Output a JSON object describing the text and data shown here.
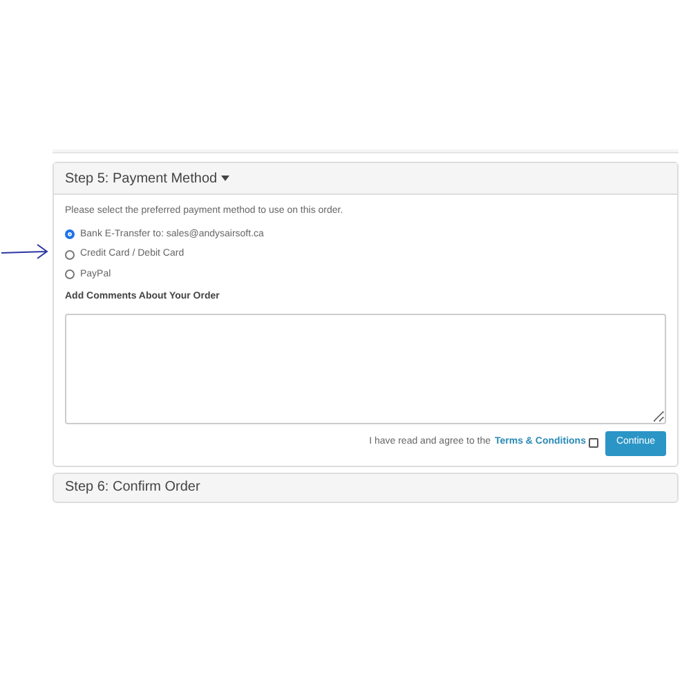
{
  "payment_panel": {
    "title": "Step 5: Payment Method",
    "intro": "Please select the preferred payment method to use on this order.",
    "options": [
      {
        "label": "Bank E-Transfer to: sales@andysairsoft.ca",
        "selected": true
      },
      {
        "label": "Credit Card / Debit Card",
        "selected": false
      },
      {
        "label": "PayPal",
        "selected": false
      }
    ],
    "comments_label": "Add Comments About Your Order",
    "agree_text": "I have read and agree to the ",
    "terms_link": "Terms & Conditions",
    "agree_checked": false,
    "continue_button": "Continue"
  },
  "confirm_panel": {
    "title": "Step 6: Confirm Order"
  }
}
